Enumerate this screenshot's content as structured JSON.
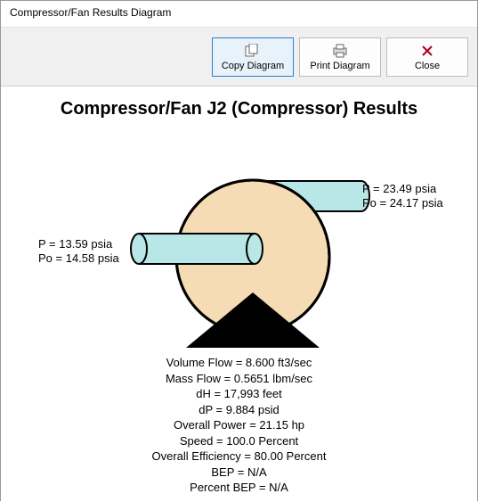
{
  "window": {
    "title": "Compressor/Fan Results Diagram"
  },
  "toolbar": {
    "copy_label": "Copy Diagram",
    "print_label": "Print Diagram",
    "close_label": "Close"
  },
  "heading": "Compressor/Fan J2 (Compressor) Results",
  "inlet": {
    "p_line": "P = 13.59 psia",
    "po_line": "Po = 14.58 psia"
  },
  "outlet": {
    "p_line": "P = 23.49 psia",
    "po_line": "Po = 24.17 psia"
  },
  "results": {
    "volume_flow": "Volume Flow = 8.600 ft3/sec",
    "mass_flow": "Mass Flow = 0.5651 lbm/sec",
    "dH": "dH = 17,993 feet",
    "dP": "dP = 9.884 psid",
    "overall_power": "Overall Power = 21.15 hp",
    "speed": "Speed = 100.0 Percent",
    "overall_efficiency": "Overall Efficiency = 80.00 Percent",
    "bep": "BEP = N/A",
    "percent_bep": "Percent BEP = N/A"
  }
}
